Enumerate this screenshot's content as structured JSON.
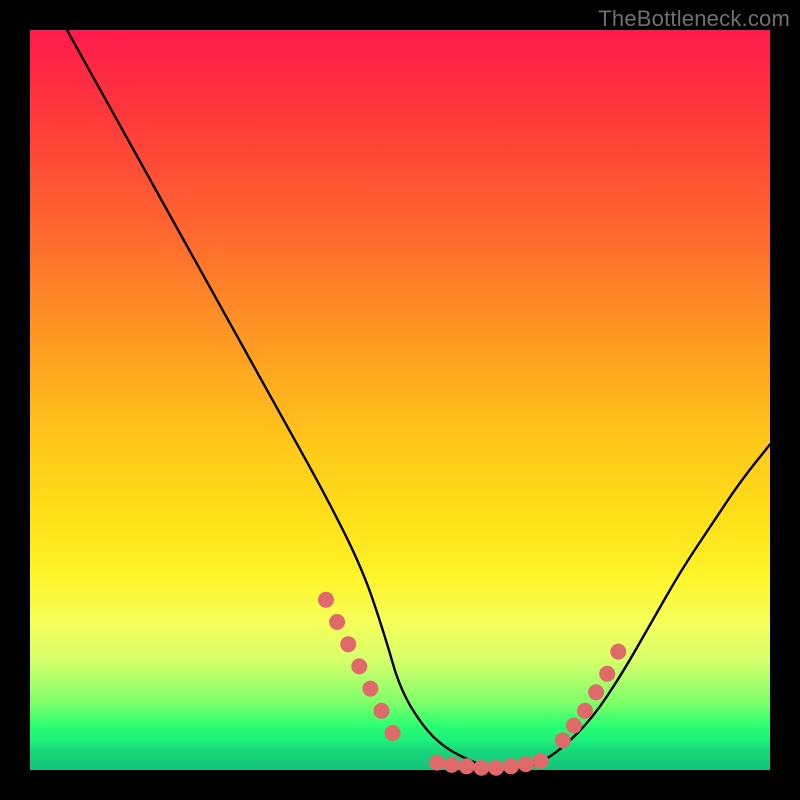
{
  "watermark": "TheBottleneck.com",
  "chart_data": {
    "type": "line",
    "title": "",
    "xlabel": "",
    "ylabel": "",
    "xlim": [
      0,
      100
    ],
    "ylim": [
      0,
      100
    ],
    "grid": false,
    "legend": false,
    "background_gradient_stops": [
      {
        "pos": 0,
        "color": "#ff1a4d"
      },
      {
        "pos": 28,
        "color": "#ff6a2e"
      },
      {
        "pos": 56,
        "color": "#ffc81a"
      },
      {
        "pos": 80,
        "color": "#f6ff5a"
      },
      {
        "pos": 94,
        "color": "#2bff70"
      },
      {
        "pos": 100,
        "color": "#14c279"
      }
    ],
    "series": [
      {
        "name": "bottleneck-curve",
        "stroke": "#000000",
        "x": [
          5,
          10,
          15,
          20,
          25,
          30,
          35,
          40,
          45,
          48,
          50,
          53,
          56,
          60,
          63,
          66,
          69,
          72,
          76,
          80,
          84,
          88,
          92,
          96,
          100
        ],
        "y": [
          100,
          91,
          82,
          73,
          64,
          55,
          46,
          37,
          27,
          18,
          11,
          6,
          3,
          1,
          0,
          0,
          1,
          3,
          7,
          13,
          20,
          27,
          33,
          39,
          44
        ]
      },
      {
        "name": "highlight-dots-left",
        "type": "scatter",
        "color": "#e06a6a",
        "x": [
          40,
          41.5,
          43,
          44.5,
          46,
          47.5,
          49
        ],
        "y": [
          23,
          20,
          17,
          14,
          11,
          8,
          5
        ]
      },
      {
        "name": "highlight-dots-bottom",
        "type": "scatter",
        "color": "#e06a6a",
        "x": [
          55,
          57,
          59,
          61,
          63,
          65,
          67,
          69
        ],
        "y": [
          1,
          0.7,
          0.5,
          0.3,
          0.3,
          0.5,
          0.8,
          1.2
        ]
      },
      {
        "name": "highlight-dots-right",
        "type": "scatter",
        "color": "#e06a6a",
        "x": [
          72,
          73.5,
          75,
          76.5,
          78,
          79.5
        ],
        "y": [
          4,
          6,
          8,
          10.5,
          13,
          16
        ]
      }
    ]
  }
}
